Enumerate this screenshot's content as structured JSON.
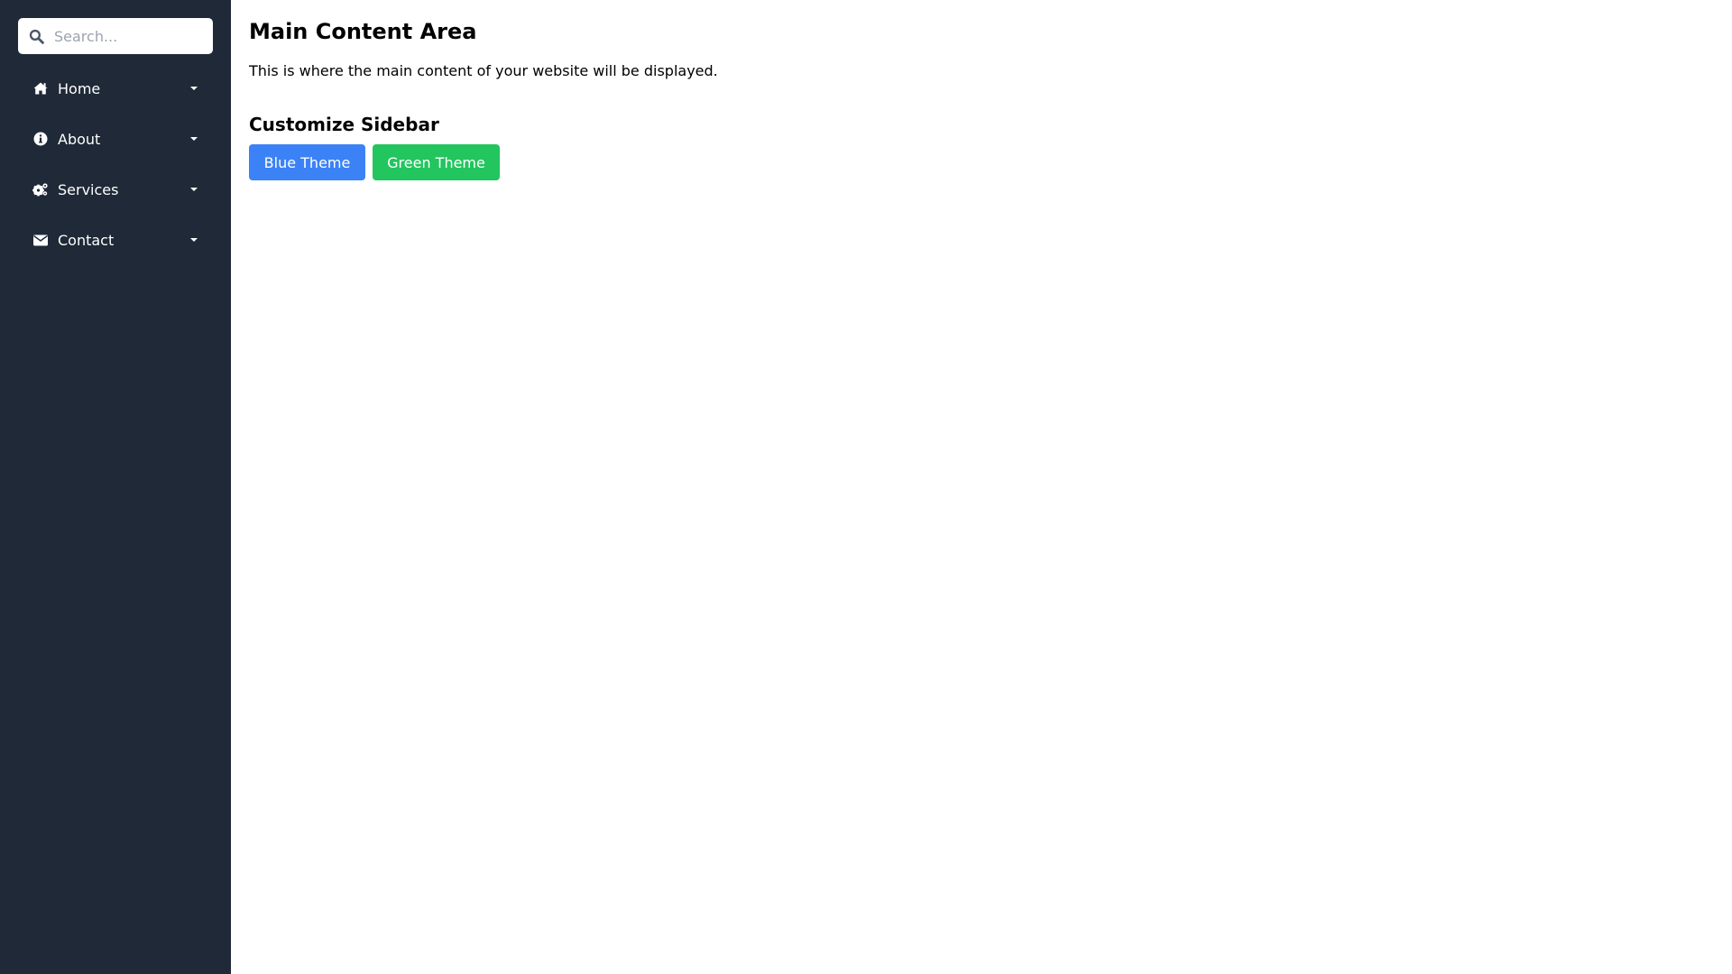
{
  "sidebar": {
    "search": {
      "placeholder": "Search...",
      "value": ""
    },
    "items": [
      {
        "label": "Home",
        "icon": "home-icon"
      },
      {
        "label": "About",
        "icon": "info-icon"
      },
      {
        "label": "Services",
        "icon": "cogs-icon"
      },
      {
        "label": "Contact",
        "icon": "envelope-icon"
      }
    ],
    "background": "#1f2937"
  },
  "main": {
    "title": "Main Content Area",
    "description": "This is where the main content of your website will be displayed.",
    "customize_heading": "Customize Sidebar",
    "buttons": {
      "blue": {
        "label": "Blue Theme",
        "color": "#3b82f6"
      },
      "green": {
        "label": "Green Theme",
        "color": "#22c55e"
      }
    }
  }
}
